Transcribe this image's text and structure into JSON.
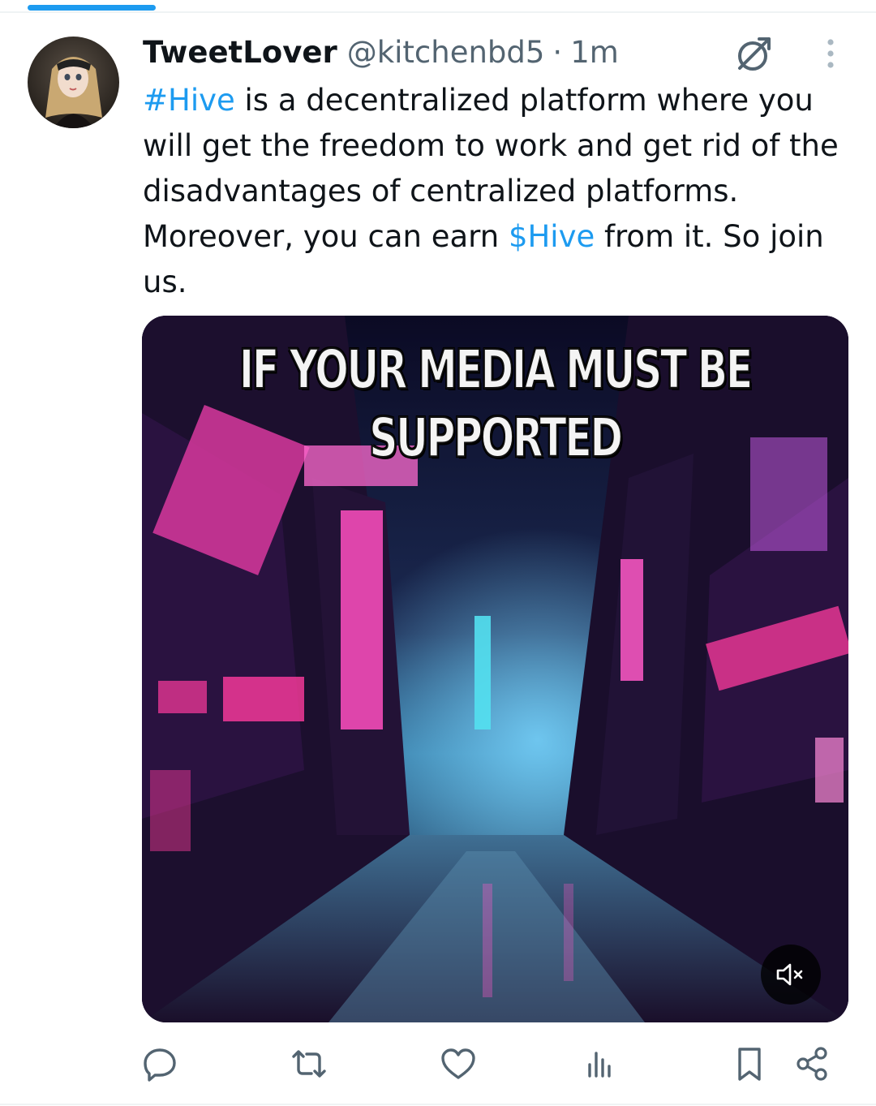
{
  "tweet": {
    "display_name": "TweetLover",
    "handle": "@kitchenbd5",
    "separator": "·",
    "time": "1m",
    "text_lines": [
      {
        "parts": [
          {
            "text": "#Hive",
            "link": true
          },
          {
            "text": " is a decentralized platform where you",
            "link": false
          }
        ]
      },
      {
        "parts": [
          {
            "text": "will get the freedom to work and get rid of the",
            "link": false
          }
        ]
      },
      {
        "parts": [
          {
            "text": "disadvantages of centralized platforms.",
            "link": false
          }
        ]
      },
      {
        "parts": [
          {
            "text": "Moreover, you can earn ",
            "link": false
          },
          {
            "text": "$Hive",
            "link": true
          },
          {
            "text": " from it. So join",
            "link": false
          }
        ]
      },
      {
        "parts": [
          {
            "text": "us.",
            "link": false
          }
        ]
      }
    ]
  },
  "media": {
    "caption_line1": "IF YOUR MEDIA MUST BE",
    "caption_line2": "SUPPORTED"
  },
  "icons": {
    "grok": "grok-icon",
    "more": "more-icon",
    "mute": "mute-icon",
    "reply": "reply-icon",
    "repost": "repost-icon",
    "like": "like-icon",
    "views": "views-icon",
    "bookmark": "bookmark-icon",
    "share": "share-icon"
  },
  "colors": {
    "link": "#1d9bf0",
    "secondary_text": "#536471",
    "primary_text": "#0f1419",
    "action_icon": "#536471"
  }
}
